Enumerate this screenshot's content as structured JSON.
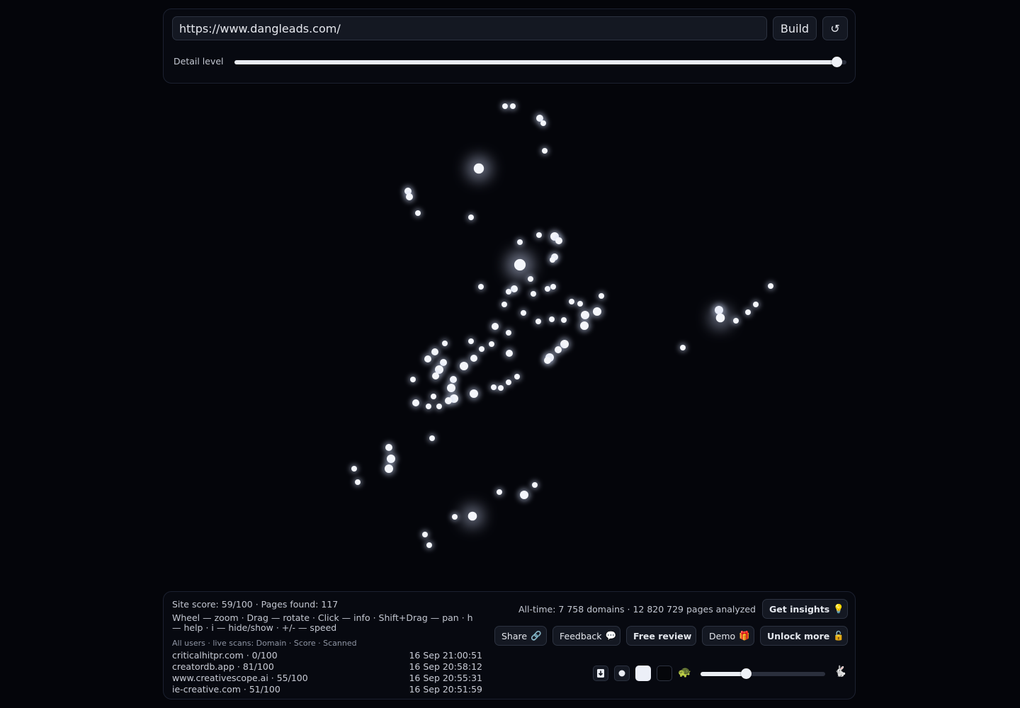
{
  "top_bar": {
    "url_value": "https://www.dangleads.com/",
    "build_label": "Build",
    "refresh_icon": "↺",
    "detail_label": "Detail level",
    "detail_level": 0.985
  },
  "stats": {
    "site": "Site score: 59/100 · Pages found: 117",
    "help": "Wheel — zoom · Drag — rotate · Click — info · Shift+Drag — pan · h — help · i — hide/show · +/- — speed",
    "alltime": "All-time: 7 758 domains · 12 820 729 pages analyzed"
  },
  "scans": {
    "header": "All users · live scans: Domain · Score · Scanned",
    "rows": [
      {
        "domain": "criticalhitpr.com · 0/100",
        "time": "16 Sep 21:00:51"
      },
      {
        "domain": "creatordb.app · 81/100",
        "time": "16 Sep 20:58:12"
      },
      {
        "domain": "www.creativescope.ai · 55/100",
        "time": "16 Sep 20:55:31"
      },
      {
        "domain": "ie-creative.com · 51/100",
        "time": "16 Sep 20:51:59"
      }
    ]
  },
  "actions": {
    "insights": {
      "label": "Get insights",
      "icon": "💡"
    },
    "share": {
      "label": "Share",
      "icon": "🔗"
    },
    "feedback": {
      "label": "Feedback",
      "icon": "💬"
    },
    "review": {
      "label": "Free review"
    },
    "demo": {
      "label": "Demo",
      "icon": "🎁"
    },
    "unlock": {
      "label": "Unlock more",
      "icon": "🔓"
    }
  },
  "controls": {
    "turtle_icon": "🐢",
    "rabbit_icon": "🐇",
    "speed_level": 0.37
  }
}
